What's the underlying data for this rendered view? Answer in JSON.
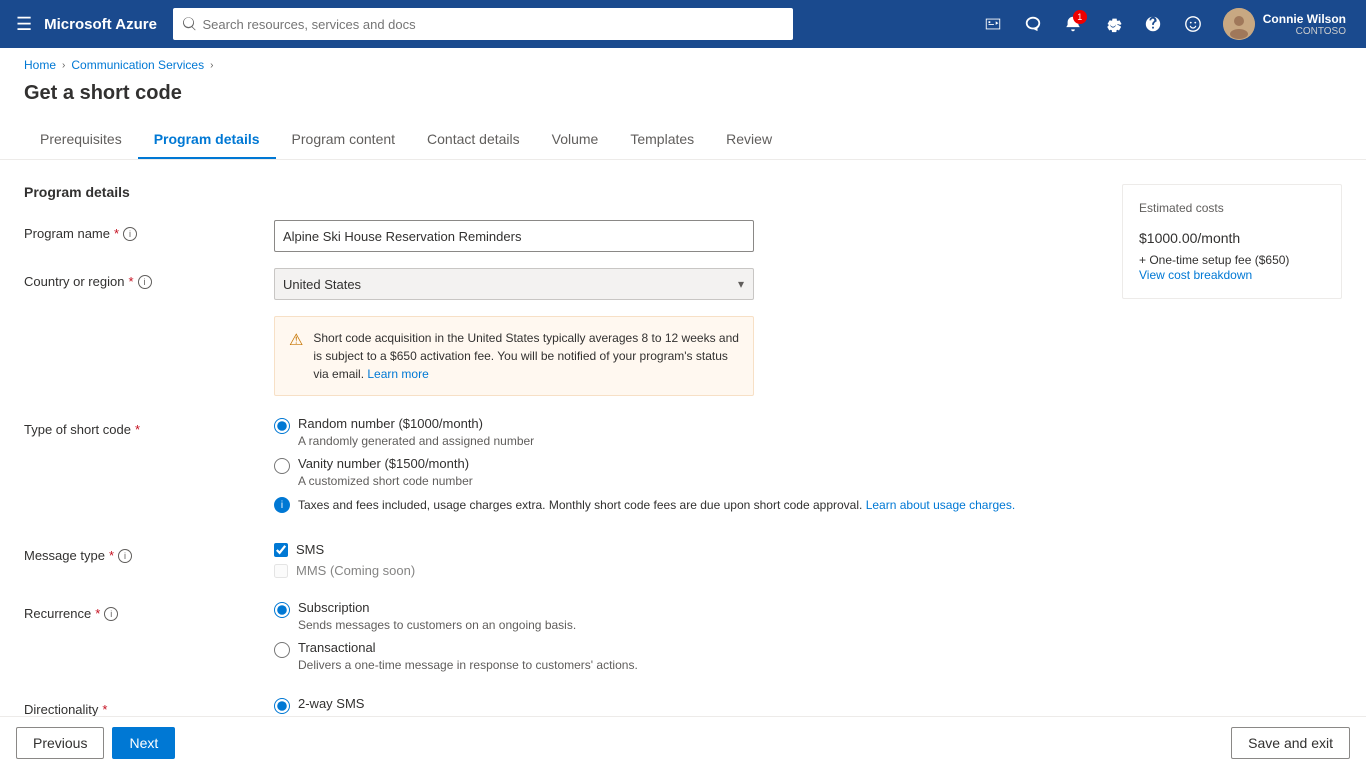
{
  "topnav": {
    "hamburger_icon": "☰",
    "logo": "Microsoft Azure",
    "search_placeholder": "Search resources, services and docs",
    "notifications_count": "1",
    "user": {
      "name": "Connie Wilson",
      "org": "CONTOSO"
    }
  },
  "breadcrumb": {
    "home": "Home",
    "service": "Communication Services"
  },
  "page": {
    "title": "Get a short code"
  },
  "tabs": [
    {
      "id": "prerequisites",
      "label": "Prerequisites",
      "active": false
    },
    {
      "id": "program-details",
      "label": "Program details",
      "active": true
    },
    {
      "id": "program-content",
      "label": "Program content",
      "active": false
    },
    {
      "id": "contact-details",
      "label": "Contact details",
      "active": false
    },
    {
      "id": "volume",
      "label": "Volume",
      "active": false
    },
    {
      "id": "templates",
      "label": "Templates",
      "active": false
    },
    {
      "id": "review",
      "label": "Review",
      "active": false
    }
  ],
  "form": {
    "section_title": "Program details",
    "program_name_label": "Program name",
    "program_name_value": "Alpine Ski House Reservation Reminders",
    "country_label": "Country or region",
    "country_value": "United States",
    "warning": {
      "text": "Short code acquisition in the United States typically averages 8 to 12 weeks and is subject to a $650 activation fee. You will be notified of your program's status via email.",
      "link_text": "Learn more",
      "link_url": "#"
    },
    "type_label": "Type of short code",
    "type_options": [
      {
        "id": "random",
        "label": "Random number ($1000/month)",
        "desc": "A randomly generated and assigned number",
        "checked": true
      },
      {
        "id": "vanity",
        "label": "Vanity number ($1500/month)",
        "desc": "A customized short code number",
        "checked": false
      }
    ],
    "type_info": {
      "text": "Taxes and fees included, usage charges extra. Monthly short code fees are due upon short code approval.",
      "link_text": "Learn about usage charges.",
      "link_url": "#"
    },
    "message_type_label": "Message type",
    "message_options": [
      {
        "id": "sms",
        "label": "SMS",
        "checked": true,
        "disabled": false
      },
      {
        "id": "mms",
        "label": "MMS (Coming soon)",
        "checked": false,
        "disabled": true
      }
    ],
    "recurrence_label": "Recurrence",
    "recurrence_options": [
      {
        "id": "subscription",
        "label": "Subscription",
        "desc": "Sends messages to customers on an ongoing basis.",
        "checked": true
      },
      {
        "id": "transactional",
        "label": "Transactional",
        "desc": "Delivers a one-time message in response to customers' actions.",
        "checked": false
      }
    ],
    "directionality_label": "Directionality",
    "directionality_options": [
      {
        "id": "two-way",
        "label": "2-way SMS",
        "checked": true
      }
    ]
  },
  "costs": {
    "title": "Estimated costs",
    "amount": "$1000.00",
    "per": "/month",
    "setup": "+ One-time setup fee ($650)",
    "link": "View cost breakdown"
  },
  "footer": {
    "previous": "Previous",
    "next": "Next",
    "save_exit": "Save and exit"
  }
}
